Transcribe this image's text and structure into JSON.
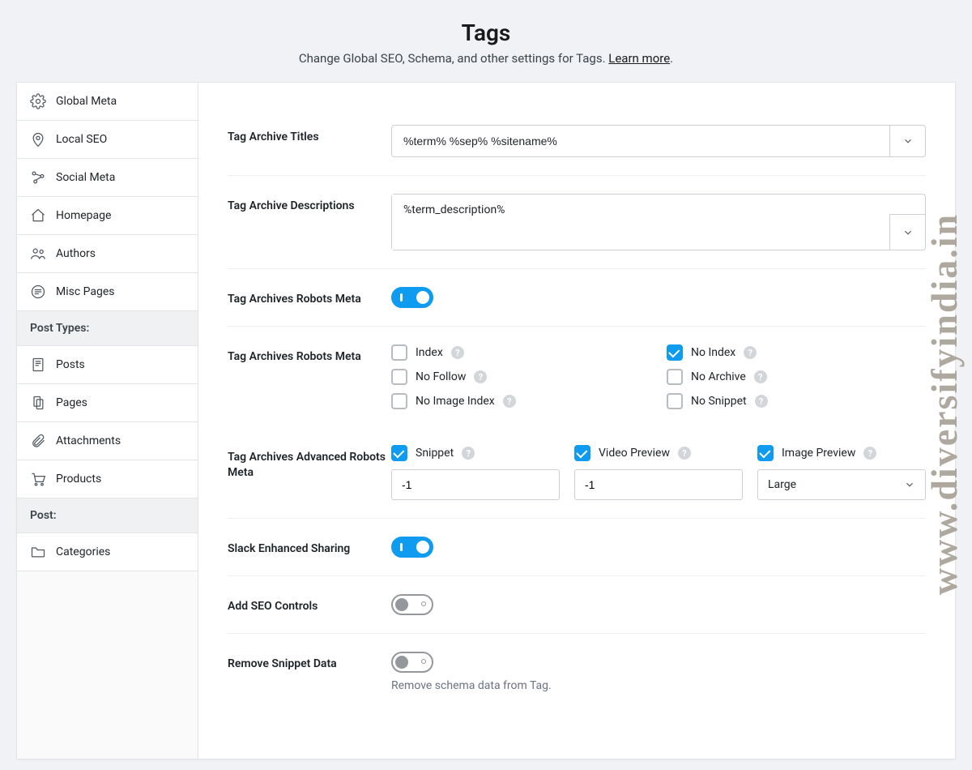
{
  "header": {
    "title": "Tags",
    "subtitle_prefix": "Change Global SEO, Schema, and other settings for Tags. ",
    "learn_more": "Learn more"
  },
  "sidebar": {
    "items_top": [
      {
        "icon": "gear-icon",
        "label": "Global Meta"
      },
      {
        "icon": "pin-icon",
        "label": "Local SEO"
      },
      {
        "icon": "share-icon",
        "label": "Social Meta"
      },
      {
        "icon": "home-icon",
        "label": "Homepage"
      },
      {
        "icon": "users-icon",
        "label": "Authors"
      },
      {
        "icon": "lines-icon",
        "label": "Misc Pages"
      }
    ],
    "group1": "Post Types:",
    "items_posttypes": [
      {
        "icon": "post-icon",
        "label": "Posts"
      },
      {
        "icon": "page-icon",
        "label": "Pages"
      },
      {
        "icon": "clip-icon",
        "label": "Attachments"
      },
      {
        "icon": "cart-icon",
        "label": "Products"
      }
    ],
    "group2": "Post:",
    "items_post": [
      {
        "icon": "folder-icon",
        "label": "Categories"
      }
    ]
  },
  "fields": {
    "archive_titles": {
      "label": "Tag Archive Titles",
      "value": "%term% %sep% %sitename%"
    },
    "archive_desc": {
      "label": "Tag Archive Descriptions",
      "value": "%term_description%"
    },
    "robots_toggle": {
      "label": "Tag Archives Robots Meta",
      "on": true
    },
    "robots_meta": {
      "label": "Tag Archives Robots Meta",
      "options": [
        {
          "label": "Index",
          "checked": false
        },
        {
          "label": "No Index",
          "checked": true
        },
        {
          "label": "No Follow",
          "checked": false
        },
        {
          "label": "No Archive",
          "checked": false
        },
        {
          "label": "No Image Index",
          "checked": false
        },
        {
          "label": "No Snippet",
          "checked": false
        }
      ]
    },
    "adv_robots": {
      "label": "Tag Archives Advanced Robots Meta",
      "cols": [
        {
          "label": "Snippet",
          "checked": true,
          "value": "-1",
          "type": "input"
        },
        {
          "label": "Video Preview",
          "checked": true,
          "value": "-1",
          "type": "input"
        },
        {
          "label": "Image Preview",
          "checked": true,
          "value": "Large",
          "type": "select"
        }
      ]
    },
    "slack": {
      "label": "Slack Enhanced Sharing",
      "on": true
    },
    "seo_ctrl": {
      "label": "Add SEO Controls",
      "on": false
    },
    "remove_snippet": {
      "label": "Remove Snippet Data",
      "on": false,
      "help": "Remove schema data from Tag."
    }
  },
  "watermark": "www.diversifyindia.in"
}
